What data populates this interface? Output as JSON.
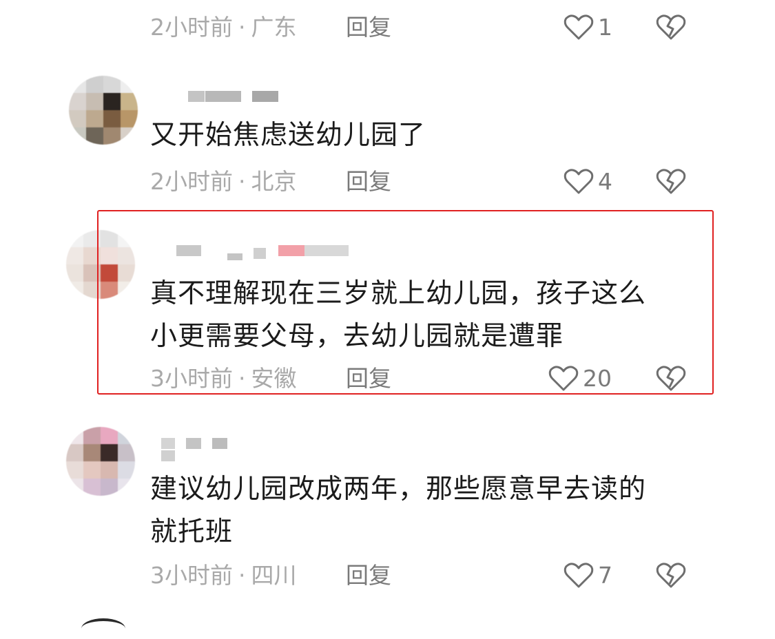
{
  "comments": [
    {
      "text_lines": [],
      "time": "2小时前",
      "location": "广东",
      "reply_label": "回复",
      "likes": "1"
    },
    {
      "text_lines": [
        "又开始焦虑送幼儿园了"
      ],
      "time": "2小时前",
      "location": "北京",
      "reply_label": "回复",
      "likes": "4"
    },
    {
      "text_lines": [
        "真不理解现在三岁就上幼儿园，孩子这么",
        "小更需要父母，去幼儿园就是遭罪"
      ],
      "time": "3小时前",
      "location": "安徽",
      "reply_label": "回复",
      "likes": "20",
      "highlighted": true
    },
    {
      "text_lines": [
        "建议幼儿园改成两年，那些愿意早去读的",
        "就托班"
      ],
      "time": "3小时前",
      "location": "四川",
      "reply_label": "回复",
      "likes": "7"
    }
  ],
  "colors": {
    "highlight_border": "#e02020",
    "meta_text": "#a9a9a9",
    "action_text": "#7a7a7a",
    "comment_text": "#1b1b1b"
  },
  "icons": {
    "like": "heart-outline-icon",
    "dislike": "broken-heart-icon"
  },
  "separator": "·"
}
